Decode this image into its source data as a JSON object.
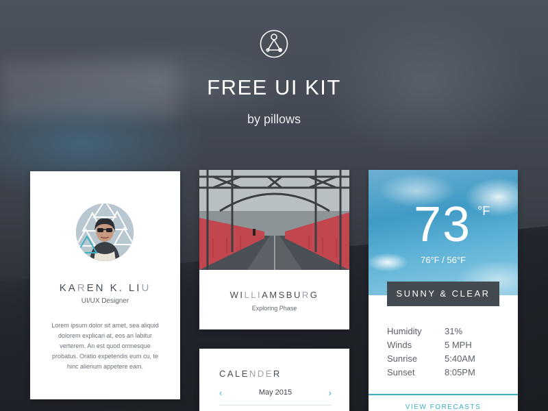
{
  "header": {
    "logo_icon": "kit-logo-icon",
    "title": "FREE UI KIT",
    "subtitle": "by pillows"
  },
  "profile": {
    "name_part1": "KA",
    "name_hl1": "R",
    "name_part2": "EN K. LI",
    "name_hl2": "U",
    "role": "UI/UX Designer",
    "bio": "Lorem ipsum dolor sit amet, sea aliquid dolorem explicari at, eos an labitur verterem. An est quod omnesque probatus. Oratio expetendis eum cu, te hinc alienum appetere eam."
  },
  "place": {
    "title_part1": "WI",
    "title_hl": "LLI",
    "title_part2": "AMSBU",
    "title_hl2": "R",
    "title_part3": "G",
    "subtitle": "Exploring Phase"
  },
  "calendar": {
    "title_part1": "CALE",
    "title_hl": "NDE",
    "title_part2": "R",
    "month": "May 2015",
    "prev_icon": "chevron-left-icon",
    "next_icon": "chevron-right-icon",
    "prev_glyph": "‹",
    "next_glyph": "›"
  },
  "weather": {
    "temperature": "73",
    "temperature_unit": "°F",
    "range": "76°F / 56°F",
    "condition": "SUNNY & CLEAR",
    "stats": [
      {
        "label": "Humidity",
        "value": "31%"
      },
      {
        "label": "Winds",
        "value": "5 MPH"
      },
      {
        "label": "Sunrise",
        "value": "5:40AM"
      },
      {
        "label": "Sunset",
        "value": "8:05PM"
      }
    ],
    "link": "VIEW FORECASTS"
  },
  "colors": {
    "accent": "#3bb1c6",
    "dark_button": "#444a52",
    "text_dark": "#464c55"
  }
}
